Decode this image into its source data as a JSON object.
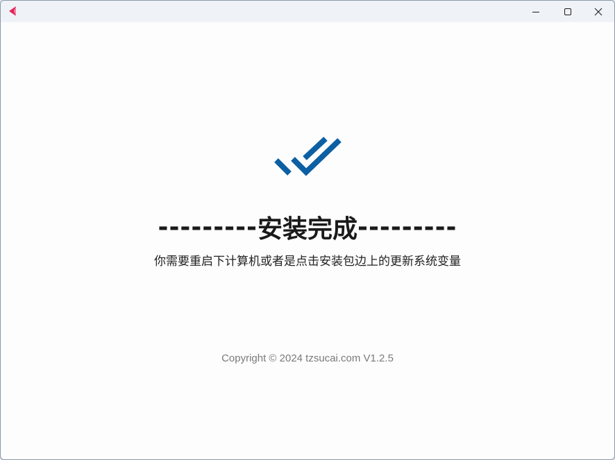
{
  "titlebar": {
    "app_icon": "app-logo-icon",
    "controls": {
      "minimize_icon": "minimize-icon",
      "maximize_icon": "maximize-icon",
      "close_icon": "close-icon"
    }
  },
  "main": {
    "status_icon": "double-check-icon",
    "title_dashes_left": "---------",
    "title_text": "安装完成",
    "title_dashes_right": "---------",
    "message": "你需要重启下计算机或者是点击安装包边上的更新系统变量",
    "copyright": "Copyright © 2024 tzsucai.com V1.2.5"
  },
  "colors": {
    "accent": "#0c5fa3",
    "title_text": "#1a1a1a",
    "copyright_text": "#7a7a7a",
    "titlebar_bg": "#eff3f8",
    "app_icon_red": "#e0245e"
  }
}
